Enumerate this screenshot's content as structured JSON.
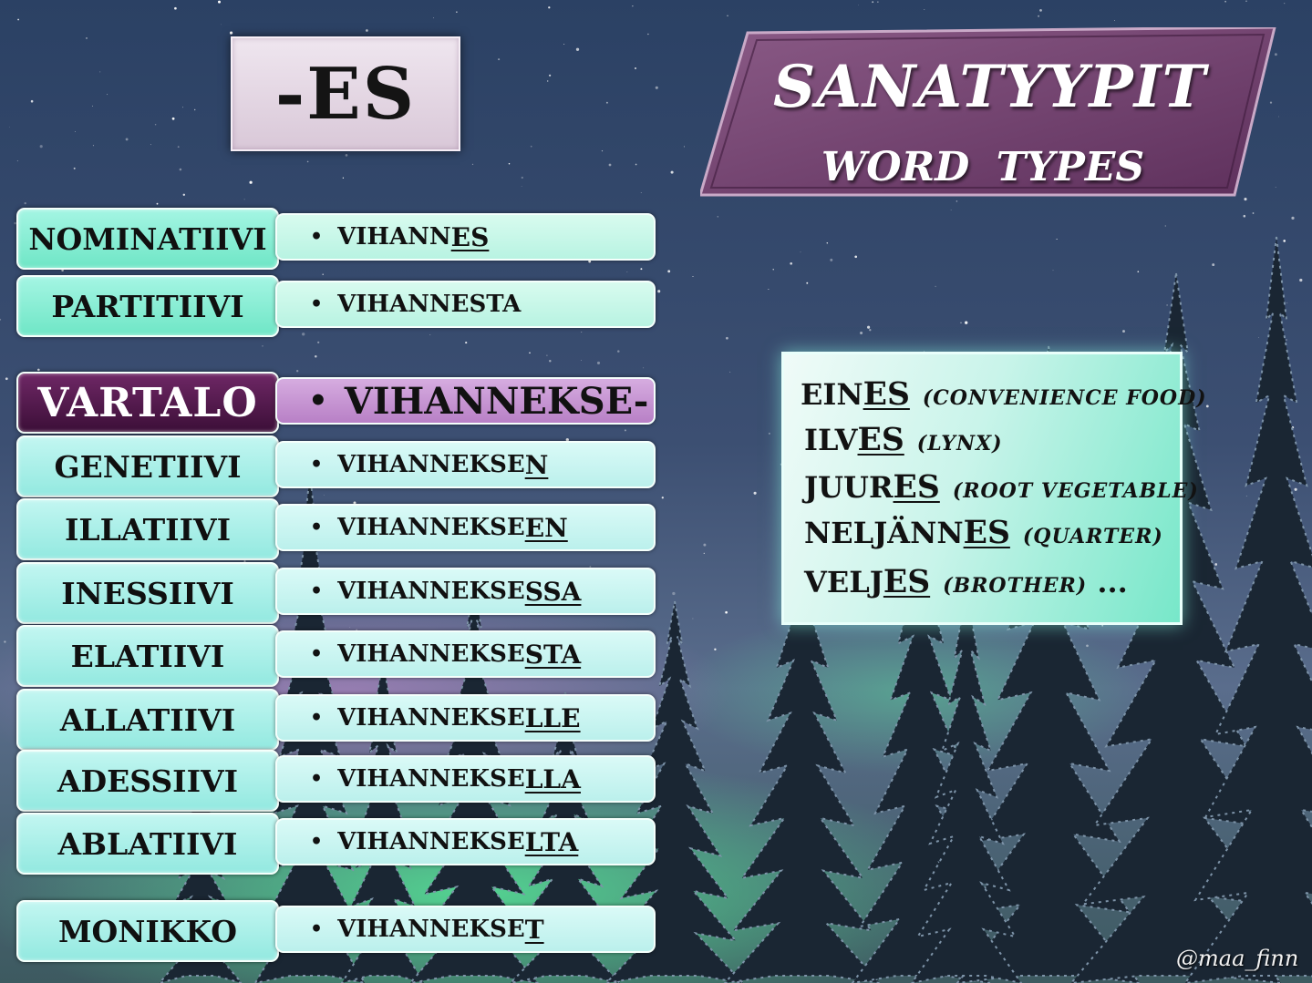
{
  "ending": "-ES",
  "title": {
    "main": "SANATYYPIT",
    "sub": "WORD TYPES"
  },
  "rows": [
    {
      "case": "NOMINATIIVI",
      "stem": "VIHANN",
      "suffix": "ES"
    },
    {
      "case": "PARTITIIVI",
      "stem": "VIHANNESTA",
      "suffix": ""
    },
    {
      "case": "VARTALO",
      "stem": "VIHANNEKSE-",
      "suffix": ""
    },
    {
      "case": "GENETIIVI",
      "stem": "VIHANNEKSE",
      "suffix": "N"
    },
    {
      "case": "ILLATIIVI",
      "stem": "VIHANNEKSE",
      "suffix": "EN"
    },
    {
      "case": "INESSIIVI",
      "stem": "VIHANNEKSE",
      "suffix": "SSA"
    },
    {
      "case": "ELATIIVI",
      "stem": "VIHANNEKSE",
      "suffix": "STA"
    },
    {
      "case": "ALLATIIVI",
      "stem": "VIHANNEKSE",
      "suffix": "LLE"
    },
    {
      "case": "ADESSIIVI",
      "stem": "VIHANNEKSE",
      "suffix": "LLA"
    },
    {
      "case": "ABLATIIVI",
      "stem": "VIHANNEKSE",
      "suffix": "LTA"
    },
    {
      "case": "MONIKKO",
      "stem": "VIHANNEKSE",
      "suffix": "T"
    }
  ],
  "bullet": "•",
  "examples": [
    {
      "stem": "EIN",
      "suffix": "ES",
      "translation": "(CONVENIENCE FOOD)"
    },
    {
      "stem": "ILV",
      "suffix": "ES",
      "translation": "(LYNX)"
    },
    {
      "stem": "JUUR",
      "suffix": "ES",
      "translation": "(ROOT VEGETABLE)"
    },
    {
      "stem": "NELJÄNN",
      "suffix": "ES",
      "translation": "(QUARTER)"
    },
    {
      "stem": "VELJ",
      "suffix": "ES",
      "translation": "(BROTHER)",
      "after": " ..."
    }
  ],
  "credit": "@maa_finn",
  "colors": {
    "mint": "#7ff0cf",
    "cyan": "#aef2ea",
    "plum": "#4a1445",
    "lilac": "#c795d3",
    "sky_top": "#243a5e",
    "aurora": "#4fe59a"
  }
}
